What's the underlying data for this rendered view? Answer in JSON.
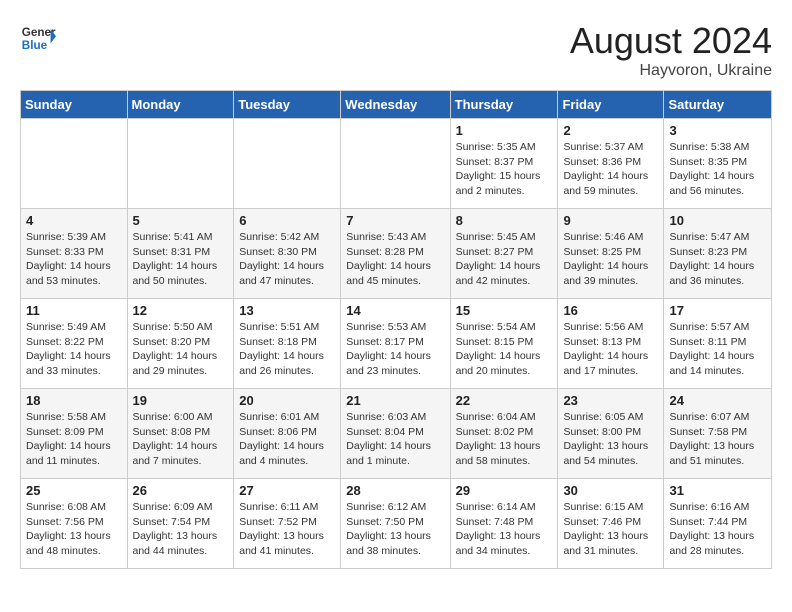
{
  "header": {
    "logo_general": "General",
    "logo_blue": "Blue",
    "month_year": "August 2024",
    "location": "Hayvoron, Ukraine"
  },
  "weekdays": [
    "Sunday",
    "Monday",
    "Tuesday",
    "Wednesday",
    "Thursday",
    "Friday",
    "Saturday"
  ],
  "weeks": [
    [
      {
        "day": "",
        "info": ""
      },
      {
        "day": "",
        "info": ""
      },
      {
        "day": "",
        "info": ""
      },
      {
        "day": "",
        "info": ""
      },
      {
        "day": "1",
        "info": "Sunrise: 5:35 AM\nSunset: 8:37 PM\nDaylight: 15 hours\nand 2 minutes."
      },
      {
        "day": "2",
        "info": "Sunrise: 5:37 AM\nSunset: 8:36 PM\nDaylight: 14 hours\nand 59 minutes."
      },
      {
        "day": "3",
        "info": "Sunrise: 5:38 AM\nSunset: 8:35 PM\nDaylight: 14 hours\nand 56 minutes."
      }
    ],
    [
      {
        "day": "4",
        "info": "Sunrise: 5:39 AM\nSunset: 8:33 PM\nDaylight: 14 hours\nand 53 minutes."
      },
      {
        "day": "5",
        "info": "Sunrise: 5:41 AM\nSunset: 8:31 PM\nDaylight: 14 hours\nand 50 minutes."
      },
      {
        "day": "6",
        "info": "Sunrise: 5:42 AM\nSunset: 8:30 PM\nDaylight: 14 hours\nand 47 minutes."
      },
      {
        "day": "7",
        "info": "Sunrise: 5:43 AM\nSunset: 8:28 PM\nDaylight: 14 hours\nand 45 minutes."
      },
      {
        "day": "8",
        "info": "Sunrise: 5:45 AM\nSunset: 8:27 PM\nDaylight: 14 hours\nand 42 minutes."
      },
      {
        "day": "9",
        "info": "Sunrise: 5:46 AM\nSunset: 8:25 PM\nDaylight: 14 hours\nand 39 minutes."
      },
      {
        "day": "10",
        "info": "Sunrise: 5:47 AM\nSunset: 8:23 PM\nDaylight: 14 hours\nand 36 minutes."
      }
    ],
    [
      {
        "day": "11",
        "info": "Sunrise: 5:49 AM\nSunset: 8:22 PM\nDaylight: 14 hours\nand 33 minutes."
      },
      {
        "day": "12",
        "info": "Sunrise: 5:50 AM\nSunset: 8:20 PM\nDaylight: 14 hours\nand 29 minutes."
      },
      {
        "day": "13",
        "info": "Sunrise: 5:51 AM\nSunset: 8:18 PM\nDaylight: 14 hours\nand 26 minutes."
      },
      {
        "day": "14",
        "info": "Sunrise: 5:53 AM\nSunset: 8:17 PM\nDaylight: 14 hours\nand 23 minutes."
      },
      {
        "day": "15",
        "info": "Sunrise: 5:54 AM\nSunset: 8:15 PM\nDaylight: 14 hours\nand 20 minutes."
      },
      {
        "day": "16",
        "info": "Sunrise: 5:56 AM\nSunset: 8:13 PM\nDaylight: 14 hours\nand 17 minutes."
      },
      {
        "day": "17",
        "info": "Sunrise: 5:57 AM\nSunset: 8:11 PM\nDaylight: 14 hours\nand 14 minutes."
      }
    ],
    [
      {
        "day": "18",
        "info": "Sunrise: 5:58 AM\nSunset: 8:09 PM\nDaylight: 14 hours\nand 11 minutes."
      },
      {
        "day": "19",
        "info": "Sunrise: 6:00 AM\nSunset: 8:08 PM\nDaylight: 14 hours\nand 7 minutes."
      },
      {
        "day": "20",
        "info": "Sunrise: 6:01 AM\nSunset: 8:06 PM\nDaylight: 14 hours\nand 4 minutes."
      },
      {
        "day": "21",
        "info": "Sunrise: 6:03 AM\nSunset: 8:04 PM\nDaylight: 14 hours\nand 1 minute."
      },
      {
        "day": "22",
        "info": "Sunrise: 6:04 AM\nSunset: 8:02 PM\nDaylight: 13 hours\nand 58 minutes."
      },
      {
        "day": "23",
        "info": "Sunrise: 6:05 AM\nSunset: 8:00 PM\nDaylight: 13 hours\nand 54 minutes."
      },
      {
        "day": "24",
        "info": "Sunrise: 6:07 AM\nSunset: 7:58 PM\nDaylight: 13 hours\nand 51 minutes."
      }
    ],
    [
      {
        "day": "25",
        "info": "Sunrise: 6:08 AM\nSunset: 7:56 PM\nDaylight: 13 hours\nand 48 minutes."
      },
      {
        "day": "26",
        "info": "Sunrise: 6:09 AM\nSunset: 7:54 PM\nDaylight: 13 hours\nand 44 minutes."
      },
      {
        "day": "27",
        "info": "Sunrise: 6:11 AM\nSunset: 7:52 PM\nDaylight: 13 hours\nand 41 minutes."
      },
      {
        "day": "28",
        "info": "Sunrise: 6:12 AM\nSunset: 7:50 PM\nDaylight: 13 hours\nand 38 minutes."
      },
      {
        "day": "29",
        "info": "Sunrise: 6:14 AM\nSunset: 7:48 PM\nDaylight: 13 hours\nand 34 minutes."
      },
      {
        "day": "30",
        "info": "Sunrise: 6:15 AM\nSunset: 7:46 PM\nDaylight: 13 hours\nand 31 minutes."
      },
      {
        "day": "31",
        "info": "Sunrise: 6:16 AM\nSunset: 7:44 PM\nDaylight: 13 hours\nand 28 minutes."
      }
    ]
  ]
}
